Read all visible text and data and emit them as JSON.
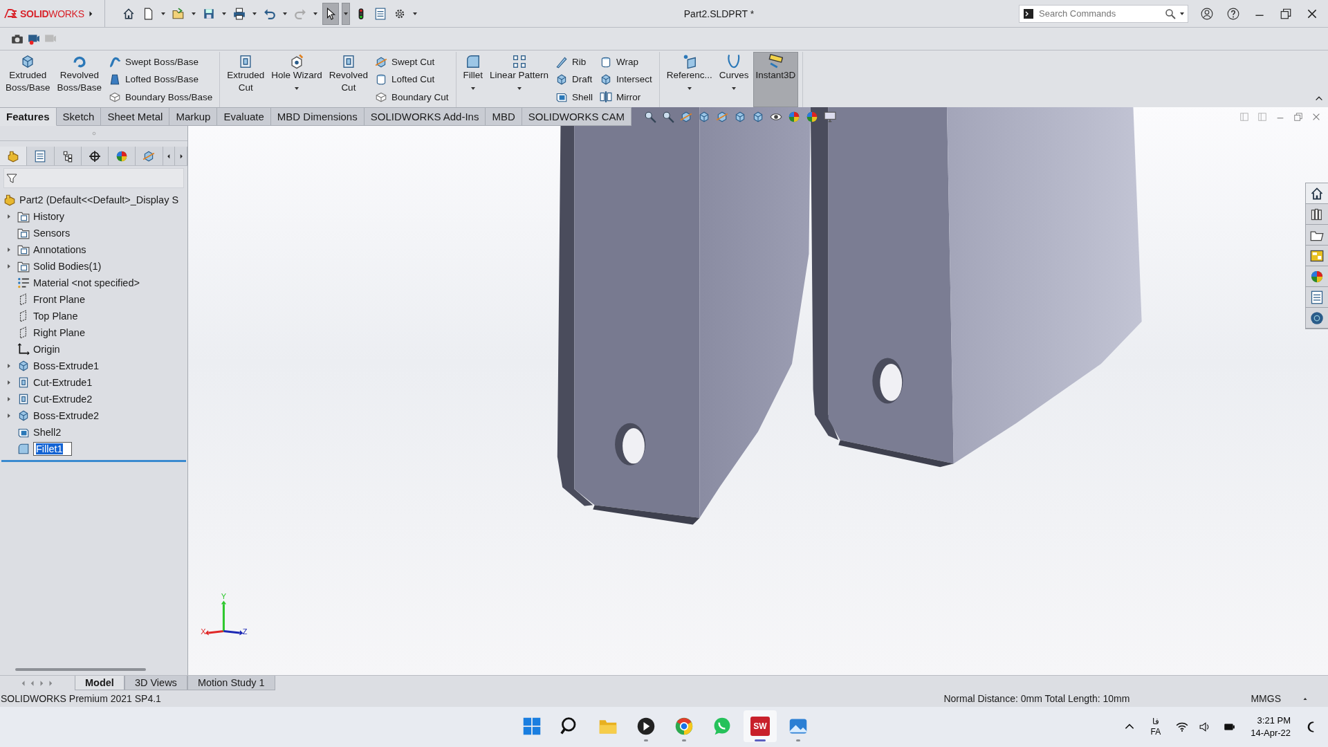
{
  "title_bar": {
    "logo": "**SOLID**WORKS",
    "document_title": "Part2.SLDPRT *",
    "search": {
      "placeholder": "Search Commands"
    }
  },
  "command_manager": {
    "groups": [
      {
        "columns": [
          {
            "kind": "large",
            "label": "Extruded\nBoss/Base",
            "dropdown": false,
            "on": false
          },
          {
            "kind": "large",
            "label": "Revolved\nBoss/Base",
            "dropdown": false,
            "on": false
          },
          {
            "kind": "stack",
            "items": [
              "Swept Boss/Base",
              "Lofted Boss/Base",
              "Boundary Boss/Base"
            ]
          }
        ]
      },
      {
        "columns": [
          {
            "kind": "large",
            "label": "Extruded\nCut",
            "dropdown": false,
            "on": false
          },
          {
            "kind": "large",
            "label": "Hole Wizard",
            "dropdown": true,
            "on": false
          },
          {
            "kind": "large",
            "label": "Revolved\nCut",
            "dropdown": false,
            "on": false
          },
          {
            "kind": "stack",
            "items": [
              "Swept Cut",
              "Lofted Cut",
              "Boundary Cut"
            ]
          }
        ]
      },
      {
        "columns": [
          {
            "kind": "large",
            "label": "Fillet",
            "dropdown": true,
            "on": false
          },
          {
            "kind": "large",
            "label": "Linear Pattern",
            "dropdown": true,
            "on": false
          },
          {
            "kind": "stack",
            "items": [
              "Rib",
              "Draft",
              "Shell"
            ]
          },
          {
            "kind": "stack",
            "items": [
              "Wrap",
              "Intersect",
              "Mirror"
            ]
          }
        ]
      },
      {
        "columns": [
          {
            "kind": "large",
            "label": "Referenc...",
            "dropdown": true,
            "on": false
          },
          {
            "kind": "large",
            "label": "Curves",
            "dropdown": true,
            "on": false
          },
          {
            "kind": "large",
            "label": "Instant3D",
            "dropdown": false,
            "on": true
          }
        ]
      }
    ]
  },
  "tabs": [
    {
      "label": "Features",
      "selected": true
    },
    {
      "label": "Sketch",
      "selected": false
    },
    {
      "label": "Sheet Metal",
      "selected": false
    },
    {
      "label": "Markup",
      "selected": false
    },
    {
      "label": "Evaluate",
      "selected": false
    },
    {
      "label": "MBD Dimensions",
      "selected": false
    },
    {
      "label": "SOLIDWORKS Add-Ins",
      "selected": false
    },
    {
      "label": "MBD",
      "selected": false
    },
    {
      "label": "SOLIDWORKS CAM",
      "selected": false
    }
  ],
  "feature_tree": {
    "root": "Part2  (Default<<Default>_Display S",
    "items": [
      {
        "label": "History",
        "kind": "folder",
        "expandable": true,
        "renaming": false
      },
      {
        "label": "Sensors",
        "kind": "folder",
        "expandable": false,
        "renaming": false
      },
      {
        "label": "Annotations",
        "kind": "folder",
        "expandable": true,
        "renaming": false
      },
      {
        "label": "Solid Bodies(1)",
        "kind": "folder",
        "expandable": true,
        "renaming": false
      },
      {
        "label": "Material <not specified>",
        "kind": "material",
        "expandable": false,
        "renaming": false
      },
      {
        "label": "Front Plane",
        "kind": "plane",
        "expandable": false,
        "renaming": false
      },
      {
        "label": "Top Plane",
        "kind": "plane",
        "expandable": false,
        "renaming": false
      },
      {
        "label": "Right Plane",
        "kind": "plane",
        "expandable": false,
        "renaming": false
      },
      {
        "label": "Origin",
        "kind": "origin",
        "expandable": false,
        "renaming": false
      },
      {
        "label": "Boss-Extrude1",
        "kind": "boss",
        "expandable": true,
        "renaming": false
      },
      {
        "label": "Cut-Extrude1",
        "kind": "cut",
        "expandable": true,
        "renaming": false
      },
      {
        "label": "Cut-Extrude2",
        "kind": "cut",
        "expandable": true,
        "renaming": false
      },
      {
        "label": "Boss-Extrude2",
        "kind": "boss",
        "expandable": true,
        "renaming": false
      },
      {
        "label": "Shell2",
        "kind": "shell",
        "expandable": false,
        "renaming": false
      },
      {
        "label": "Fillet1",
        "kind": "fillet",
        "expandable": false,
        "renaming": true
      }
    ]
  },
  "triad": [
    {
      "label": "X",
      "color": "#e02828"
    },
    {
      "label": "Y",
      "color": "#2ec82e"
    },
    {
      "label": "Z",
      "color": "#1c28b4"
    }
  ],
  "bottom_tabs": [
    {
      "label": "Model",
      "selected": true
    },
    {
      "label": "3D Views",
      "selected": false
    },
    {
      "label": "Motion Study 1",
      "selected": false
    }
  ],
  "status_bar": {
    "product": "SOLIDWORKS Premium 2021 SP4.1",
    "measure": "Normal Distance: 0mm Total Length: 10mm",
    "units": "MMGS"
  },
  "taskbar": {
    "apps": [
      {
        "kind": "start",
        "running": false,
        "selected": false
      },
      {
        "kind": "search",
        "running": false,
        "selected": false
      },
      {
        "kind": "files",
        "running": false,
        "selected": false
      },
      {
        "kind": "player",
        "running": true,
        "selected": false
      },
      {
        "kind": "browser",
        "running": true,
        "selected": false
      },
      {
        "kind": "chat",
        "running": false,
        "selected": false
      },
      {
        "kind": "cad",
        "label": "SW",
        "running": true,
        "selected": true
      },
      {
        "kind": "photos",
        "running": true,
        "selected": false
      }
    ],
    "language": {
      "script": "فا",
      "code": "FA"
    },
    "time": "3:21 PM",
    "date": "14-Apr-22"
  }
}
